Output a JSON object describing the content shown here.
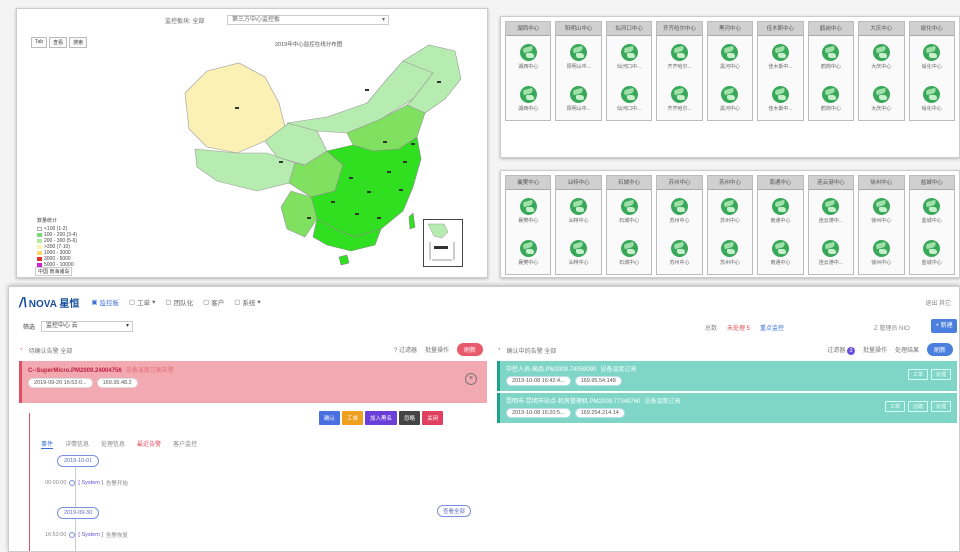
{
  "map": {
    "select_label": "监控板块: 全部",
    "select_value": "第三方中心监控板",
    "tabs": [
      "Tab",
      "查看",
      "搜索"
    ],
    "title": "2019年中心监控在线分布图",
    "legend_title": "数量统计",
    "legend": [
      {
        "label": "<100 (1-2)",
        "color": "#ffffff"
      },
      {
        "label": "100 - 200 (3-4)",
        "color": "#7ed77e"
      },
      {
        "label": "200 - 300 (5-6)",
        "color": "#b6e8a0"
      },
      {
        "label": ">300 (7-10)",
        "color": "#fff3b0"
      },
      {
        "label": "1000 - 3000",
        "color": "#ffd86b"
      },
      {
        "label": "3000 - 5000",
        "color": "#e03030"
      },
      {
        "label": "5000 - 10000",
        "color": "#d020d0"
      }
    ],
    "footer": "中国 南海诸岛",
    "colors": {
      "light": "#b6ecb0",
      "mid": "#80e060",
      "strong": "#30e020",
      "yellow": "#fbf1b4"
    }
  },
  "grid_top": {
    "columns": [
      {
        "header": "湖西中心",
        "cap": "湖西中心"
      },
      {
        "header": "阳明山中心",
        "cap": "阳明山中..."
      },
      {
        "header": "仙河口中心",
        "cap": "仙河口中..."
      },
      {
        "header": "齐齐哈尔中心",
        "cap": "齐齐哈尔..."
      },
      {
        "header": "黑河中心",
        "cap": "黑河中心"
      },
      {
        "header": "佳木斯中心",
        "cap": "佳木斯中..."
      },
      {
        "header": "鹤岗中心",
        "cap": "鹤岗中心"
      },
      {
        "header": "大庆中心",
        "cap": "大庆中心"
      },
      {
        "header": "绥化中心",
        "cap": "绥化中心"
      }
    ]
  },
  "grid_bottom": {
    "columns": [
      {
        "header": "襄樊中心",
        "cap": "襄樊中心"
      },
      {
        "header": "汕特中心",
        "cap": "汕特中心"
      },
      {
        "header": "石城中心",
        "cap": "石城中心"
      },
      {
        "header": "苏州中心",
        "cap": "苏州中心"
      },
      {
        "header": "苏州中心",
        "cap": "苏州中心"
      },
      {
        "header": "南通中心",
        "cap": "南通中心"
      },
      {
        "header": "连云港中心",
        "cap": "连云港中..."
      },
      {
        "header": "徐州中心",
        "cap": "徐州中心"
      },
      {
        "header": "盐城中心",
        "cap": "盐城中心"
      }
    ]
  },
  "app": {
    "logo": "NOVA 星恒",
    "nav": [
      "监控板",
      "工单",
      "团队化",
      "客户",
      "系统"
    ],
    "nav_right": "退出 其它",
    "sub_label": "筛选",
    "sub_select": "监控中心 云",
    "sub_right": [
      {
        "text": "总数",
        "tone": "gray"
      },
      {
        "text": "未处理 5",
        "tone": "red"
      },
      {
        "text": "重点监控",
        "tone": "blue"
      }
    ],
    "user_text": "Z 管理员 NIO",
    "add_btn": "+ 新建",
    "left": {
      "title": "待确认告警 全部",
      "tools": [
        "? 过滤器",
        "批量操作"
      ],
      "pill": "刷新",
      "card_title": "C--SuperMicro.PM2009.24004756",
      "card_status": "设备温度过高告警",
      "card_time": "2019-09-20 16:52:0...",
      "card_ip": "169.95.48.2",
      "actions": [
        {
          "label": "确认",
          "color": "#4a6fe0"
        },
        {
          "label": "工单",
          "color": "#f0a020"
        },
        {
          "label": "加入黑名",
          "color": "#6a3fd8"
        },
        {
          "label": "忽略",
          "color": "#444444"
        },
        {
          "label": "关闭",
          "color": "#e04060"
        }
      ],
      "tabs": [
        "事件",
        "详情信息",
        "处理信息",
        "最近告警",
        "客户监控"
      ],
      "dates": [
        "2019-10-01",
        "2019-09-30"
      ],
      "entries": [
        {
          "time": "00:00:00",
          "sys": "[ System ]",
          "msg": "告警开始"
        },
        {
          "time": "16:52:00",
          "sys": "[ System ]",
          "msg": "告警恢复"
        }
      ],
      "refresh": "查看全部"
    },
    "right": {
      "title": "确认中的告警 全部",
      "tools": [
        "过滤器",
        "批量操作",
        "处理结果"
      ],
      "tool_badge": "3",
      "pill": "刷新",
      "cards": [
        {
          "title": "中控人员-高品.PM2009.74059090",
          "status": "设备温度过高",
          "time": "2019-10-08 16:42:4...",
          "ip": "169.95.54.148"
        },
        {
          "title": "昆明市-昆明市站点-机房管理机.PM2009.77349760",
          "status": "设备温度过高",
          "time": "2019-10-08 16:20:5...",
          "ip": "169.254.214.14"
        }
      ],
      "card_btns": [
        "工单",
        "创建",
        "处理"
      ]
    }
  }
}
